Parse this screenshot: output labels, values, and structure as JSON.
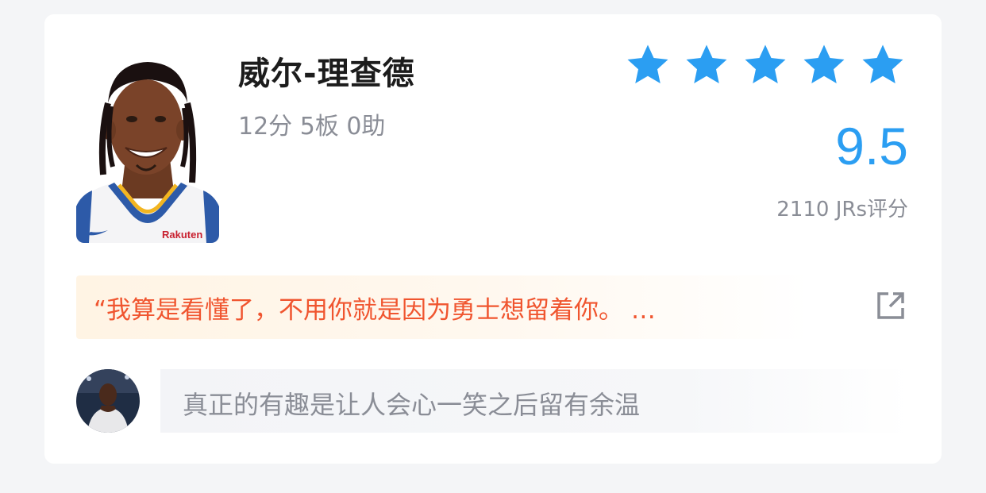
{
  "player": {
    "name": "威尔-理查德",
    "stats": "12分 5板 0助",
    "jersey_brand": "Rakuten"
  },
  "rating": {
    "stars": 5,
    "score": "9.5",
    "raters": "2110 JRs评分",
    "star_color": "#2b9ef2"
  },
  "quote": {
    "text": "“我算是看懂了，不用你就是因为勇士想留着你。 …",
    "color": "#f0552f",
    "share_icon": "share-external-icon"
  },
  "comment": {
    "placeholder": "真正的有趣是让人会心一笑之后留有余温"
  }
}
